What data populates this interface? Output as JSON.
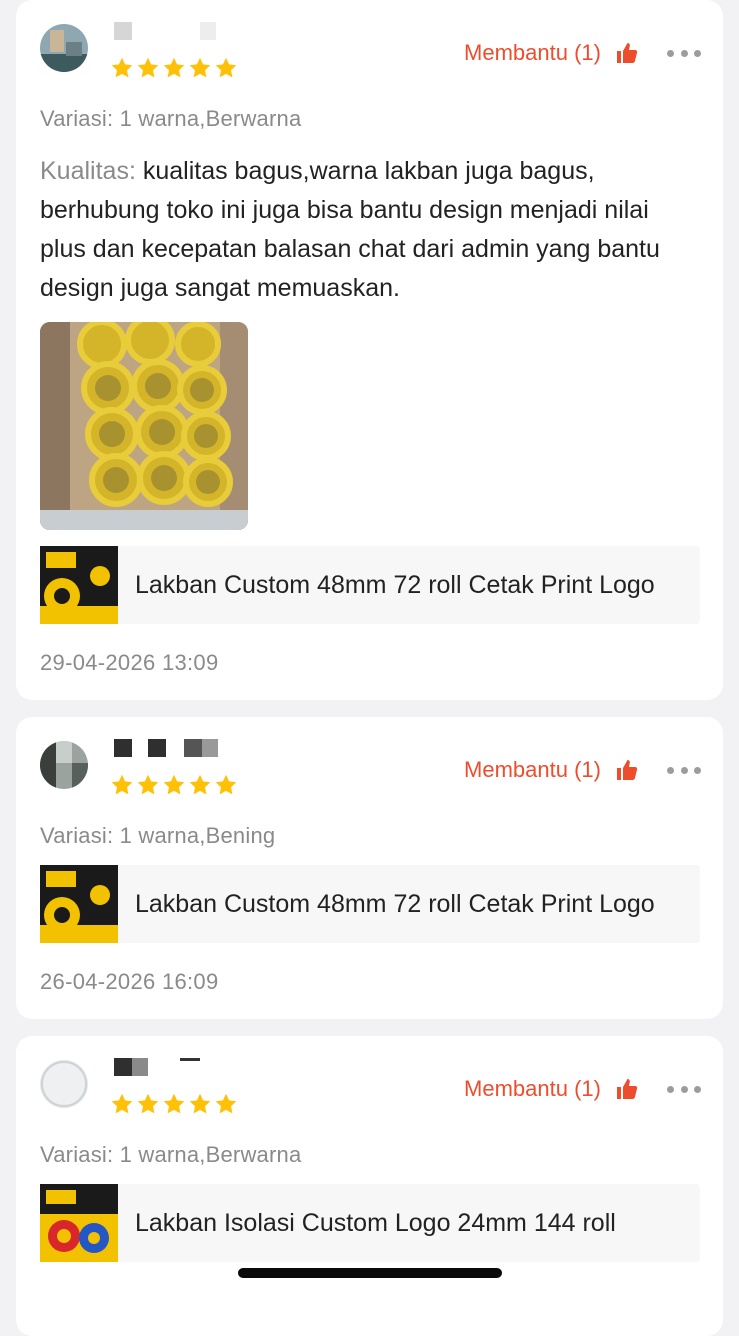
{
  "reviews": [
    {
      "helpful_label": "Membantu (1)",
      "rating": 5,
      "variation": "Variasi: 1 warna,Berwarna",
      "text_label": "Kualitas:",
      "text": "kualitas bagus,warna lakban juga bagus, berhubung toko ini juga bisa bantu design menjadi nilai plus dan kecepatan balasan chat dari admin yang bantu design juga sangat memuaskan.",
      "product_name": "Lakban Custom 48mm 72 roll Cetak Print Logo",
      "date": "29-04-2026 13:09"
    },
    {
      "helpful_label": "Membantu (1)",
      "rating": 5,
      "variation": "Variasi: 1 warna,Bening",
      "product_name": "Lakban Custom 48mm 72 roll Cetak Print Logo",
      "date": "26-04-2026 16:09"
    },
    {
      "helpful_label": "Membantu (1)",
      "rating": 5,
      "variation": "Variasi: 1 warna,Berwarna",
      "product_name": "Lakban Isolasi Custom Logo 24mm 144 roll",
      "date": ""
    }
  ],
  "icons": {
    "star": "star-icon",
    "helpful": "thumbs-up-icon",
    "more": "more-options-icon"
  },
  "colors": {
    "accent": "#ee4d2d",
    "star": "#ffc107",
    "muted_text": "#8a8a8a"
  }
}
